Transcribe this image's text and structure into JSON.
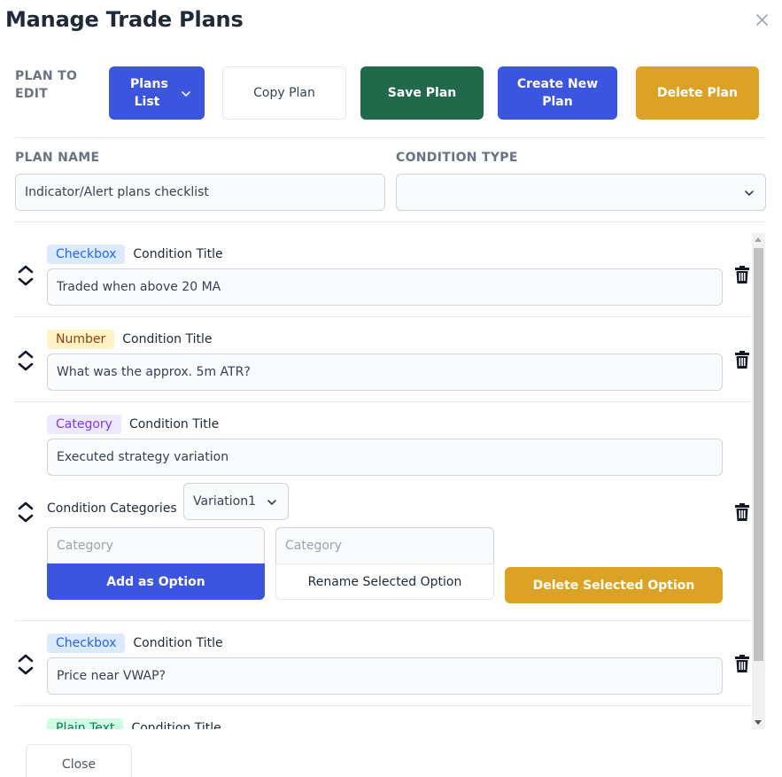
{
  "dialog": {
    "title": "Manage Trade Plans"
  },
  "toolbar": {
    "plan_to_edit_label": "PLAN TO EDIT",
    "plans_list_label": "Plans List",
    "copy_plan_label": "Copy Plan",
    "save_plan_label": "Save Plan",
    "create_new_plan_label": "Create New Plan",
    "delete_plan_label": "Delete Plan"
  },
  "form": {
    "plan_name_label": "PLAN NAME",
    "plan_name_value": "Indicator/Alert plans checklist",
    "condition_type_label": "CONDITION TYPE",
    "condition_type_value": ""
  },
  "conditions": [
    {
      "type": "Checkbox",
      "title_label": "Condition Title",
      "value": "Traded when above 20 MA"
    },
    {
      "type": "Number",
      "title_label": "Condition Title",
      "value": "What was the approx. 5m ATR?"
    },
    {
      "type": "Category",
      "title_label": "Condition Title",
      "value": "Executed strategy variation",
      "categories_label": "Condition Categories",
      "selected_category": "Variation1",
      "category_placeholder_1": "Category",
      "category_placeholder_2": "Category",
      "add_option_label": "Add as Option",
      "rename_option_label": "Rename Selected Option",
      "delete_option_label": "Delete Selected Option"
    },
    {
      "type": "Checkbox",
      "title_label": "Condition Title",
      "value": "Price near VWAP?"
    },
    {
      "type": "Plain Text",
      "title_label": "Condition Title",
      "value": ""
    }
  ],
  "footer": {
    "close_label": "Close"
  },
  "colors": {
    "primary_blue": "#3b55df",
    "save_green": "#21694b",
    "delete_gold": "#dca226"
  }
}
